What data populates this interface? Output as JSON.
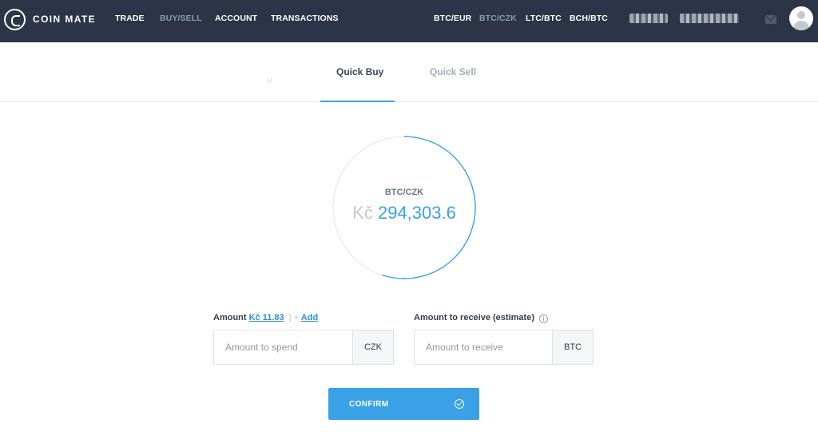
{
  "brand": {
    "name": "COIN MATE"
  },
  "nav": {
    "trade": "TRADE",
    "buy_sell": "BUY/SELL",
    "account": "ACCOUNT",
    "transactions": "TRANSACTIONS"
  },
  "pairs": [
    "BTC/EUR",
    "BTC/CZK",
    "LTC/BTC",
    "BCH/BTC"
  ],
  "active_pair_index": 1,
  "tabs": [
    {
      "label": "Quick Buy",
      "active": true
    },
    {
      "label": "Quick Sell",
      "active": false
    }
  ],
  "rate": {
    "pair": "BTC/CZK",
    "currency_symbol": "Kč",
    "value": "294,303.6",
    "progress": 0.55
  },
  "amount": {
    "label": "Amount",
    "balance": "Kč 11.83",
    "separator": "|",
    "add_symbol": "+",
    "add_label": "Add",
    "placeholder": "Amount to spend",
    "unit": "CZK"
  },
  "receive": {
    "label": "Amount to receive (estimate)",
    "info_symbol": "i",
    "placeholder": "Amount to receive",
    "unit": "BTC"
  },
  "confirm": {
    "label": "CONFIRM"
  },
  "colors": {
    "topbar": "#2b3547",
    "accent": "#3aa1e6",
    "text": "#333d4e",
    "muted": "#a3acb9"
  },
  "icons": [
    "logo-icon",
    "mail-icon",
    "user-avatar-icon",
    "info-icon",
    "check-circle-icon"
  ]
}
